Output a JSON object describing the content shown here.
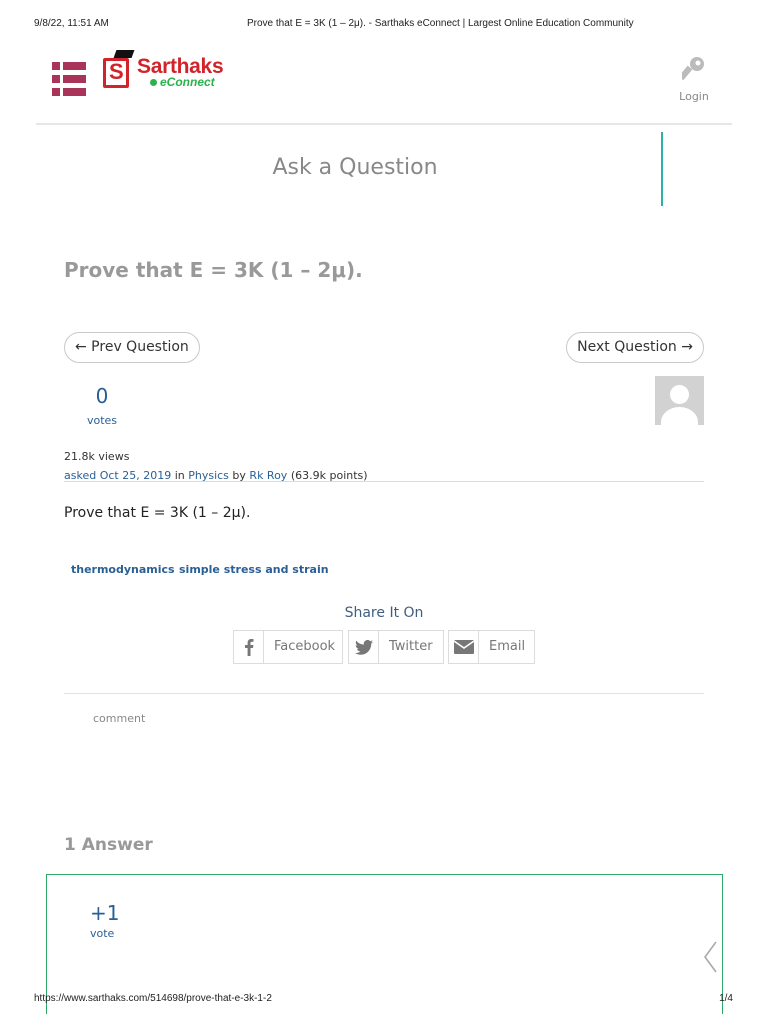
{
  "print_header": {
    "datetime": "9/8/22, 11:51 AM",
    "doc_title": "Prove that E = 3K (1 – 2μ). - Sarthaks eConnect | Largest Online Education Community"
  },
  "header": {
    "logo": {
      "name": "Sarthaks",
      "sub": "eConnect"
    },
    "login_label": "Login",
    "ask_label": "Ask a Question"
  },
  "question": {
    "title": "Prove that E = 3K (1 – 2μ).",
    "prev_label": "← Prev Question",
    "next_label": "Next Question →",
    "votes": "0",
    "votes_label": "votes",
    "views": "21.8k views",
    "asked_label": "asked",
    "date": "Oct 25, 2019",
    "in_label": "in",
    "category": "Physics",
    "by_label": "by",
    "author": "Rk Roy",
    "points": "(63.9k points)",
    "body": "Prove that E = 3K (1 – 2μ).",
    "tags": [
      "thermodynamics",
      "simple stress and strain"
    ]
  },
  "share": {
    "title": "Share It On",
    "buttons": [
      {
        "label": "Facebook",
        "icon": "facebook-icon"
      },
      {
        "label": "Twitter",
        "icon": "twitter-icon"
      },
      {
        "label": "Email",
        "icon": "email-icon"
      }
    ]
  },
  "comment_label": "comment",
  "answers": {
    "heading": "1 Answer",
    "first": {
      "votes": "+1",
      "votes_label": "vote"
    }
  },
  "print_footer": {
    "url": "https://www.sarthaks.com/514698/prove-that-e-3k-1-2",
    "page": "1/4"
  },
  "colors": {
    "brand_red": "#d2232a",
    "brand_green": "#2bb24c",
    "menu": "#a8345a",
    "link": "#2a5f96",
    "accent_teal": "#2ab3a5"
  }
}
